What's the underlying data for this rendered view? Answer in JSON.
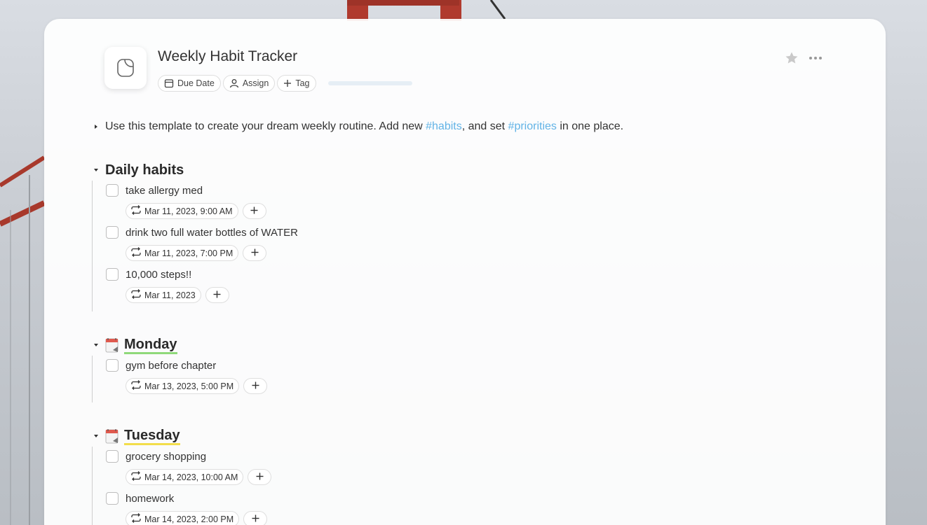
{
  "page": {
    "title": "Weekly Habit Tracker",
    "chips": {
      "due_date": "Due Date",
      "assign": "Assign",
      "tag": "Tag"
    },
    "progress": 0
  },
  "intro": {
    "before": "Use this template to create your dream weekly routine. Add new ",
    "tag1": "#habits",
    "middle": ", and set ",
    "tag2": "#priorities",
    "after": " in one place."
  },
  "sections": {
    "daily": {
      "title": "Daily habits",
      "tasks": [
        {
          "text": "take allergy med",
          "date": "Mar 11, 2023, 9:00 AM"
        },
        {
          "text": "drink two full water bottles of WATER",
          "date": "Mar 11, 2023, 7:00 PM"
        },
        {
          "text": "10,000 steps!!",
          "date": "Mar 11, 2023"
        }
      ]
    },
    "monday": {
      "title": "Monday",
      "tasks": [
        {
          "text": "gym before chapter",
          "date": "Mar 13, 2023, 5:00 PM"
        }
      ]
    },
    "tuesday": {
      "title": "Tuesday",
      "tasks": [
        {
          "text": "grocery shopping",
          "date": "Mar 14, 2023, 10:00 AM"
        },
        {
          "text": "homework",
          "date": "Mar 14, 2023, 2:00 PM"
        }
      ]
    }
  },
  "colors": {
    "tag": "#62b3e6",
    "monday_highlight": "#8fd97a",
    "tuesday_highlight": "#f2dd4b"
  },
  "icons": [
    "page-icon",
    "calendar-icon",
    "person-icon",
    "plus-icon",
    "star-icon",
    "more-icon",
    "repeat-icon",
    "caret-right-icon",
    "caret-down-icon",
    "calendar-emoji-icon"
  ]
}
